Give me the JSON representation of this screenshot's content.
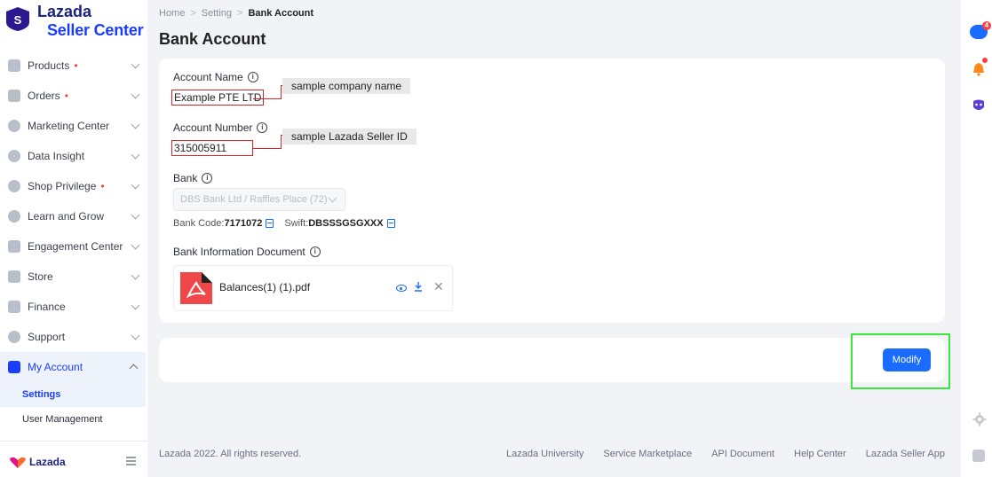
{
  "brand": {
    "name": "Lazada",
    "subtitle": "Seller Center",
    "logo_letter": "S",
    "footer_name": "Lazada"
  },
  "sidebar": {
    "items": [
      {
        "label": "Products",
        "dot": "•"
      },
      {
        "label": "Orders",
        "dot": "•"
      },
      {
        "label": "Marketing Center",
        "dot": ""
      },
      {
        "label": "Data Insight",
        "dot": ""
      },
      {
        "label": "Shop Privilege",
        "dot": "•"
      },
      {
        "label": "Learn and Grow",
        "dot": ""
      },
      {
        "label": "Engagement Center",
        "dot": ""
      },
      {
        "label": "Store",
        "dot": ""
      },
      {
        "label": "Finance",
        "dot": ""
      },
      {
        "label": "Support",
        "dot": ""
      },
      {
        "label": "My Account",
        "dot": ""
      }
    ],
    "sub_items": [
      {
        "label": "Settings"
      },
      {
        "label": "User Management"
      }
    ]
  },
  "breadcrumb": {
    "home": "Home",
    "sep": ">",
    "setting": "Setting",
    "current": "Bank Account"
  },
  "page": {
    "title": "Bank Account"
  },
  "form": {
    "account_name_label": "Account Name",
    "account_name_value": "Example PTE LTD",
    "account_name_callout": "sample company name",
    "account_number_label": "Account Number",
    "account_number_value": "315005911",
    "account_number_callout": "sample Lazada Seller ID",
    "bank_label": "Bank",
    "bank_value": "DBS Bank Ltd / Raffles Place (72)",
    "bank_code_label": "Bank Code:",
    "bank_code_value": "7171072",
    "swift_label": "Swift:",
    "swift_value": "DBSSSGSGXXX",
    "doc_label": "Bank Information Document",
    "doc_name": "Balances(1) (1).pdf",
    "info_glyph": "i",
    "close_glyph": "✕"
  },
  "actions": {
    "modify_label": "Modify"
  },
  "footer": {
    "copyright": "Lazada 2022. All rights reserved.",
    "links": [
      "Lazada University",
      "Service Marketplace",
      "API Document",
      "Help Center",
      "Lazada Seller App"
    ]
  },
  "rail": {
    "chat_badge": "4"
  },
  "colors": {
    "primary": "#1a6bff",
    "brand_dark": "#1a237e",
    "annotation_red": "#d6242c",
    "highlight_green": "#3de63d"
  },
  "icons": [
    "lazada-logo",
    "products-icon",
    "orders-icon",
    "marketing-icon",
    "data-insight-icon",
    "shop-privilege-icon",
    "learn-grow-icon",
    "engagement-icon",
    "store-icon",
    "finance-icon",
    "support-icon",
    "my-account-icon",
    "info-icon",
    "copy-icon",
    "pdf-icon",
    "eye-icon",
    "download-icon",
    "close-icon",
    "chat-icon",
    "bell-icon",
    "bot-icon",
    "gear-icon",
    "edit-icon",
    "collapse-icon"
  ]
}
